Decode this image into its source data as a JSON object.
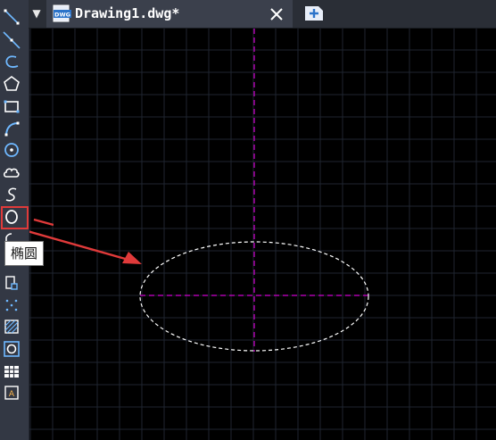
{
  "tabs": {
    "active": {
      "title": "Drawing1.dwg*",
      "icon": "dwg-file-icon"
    },
    "menu_icon": "▼",
    "new_tab_icon": "new-tab-icon"
  },
  "toolbar": {
    "tools": [
      {
        "name": "line-icon"
      },
      {
        "name": "construction-line-icon"
      },
      {
        "name": "polyline-icon"
      },
      {
        "name": "polygon-icon"
      },
      {
        "name": "rectangle-icon"
      },
      {
        "name": "arc-icon"
      },
      {
        "name": "circle-icon"
      },
      {
        "name": "revision-cloud-icon"
      },
      {
        "name": "spline-icon"
      },
      {
        "name": "ellipse-icon",
        "active": true
      },
      {
        "name": "insert-block-icon"
      },
      {
        "name": "make-block-icon"
      },
      {
        "name": "point-icon"
      },
      {
        "name": "hatch-icon"
      },
      {
        "name": "region-icon"
      },
      {
        "name": "table-icon"
      },
      {
        "name": "multiline-text-icon"
      }
    ]
  },
  "tooltip": {
    "text": "椭圆"
  },
  "colors": {
    "toolbar_bg": "#333844",
    "canvas_bg": "#000000",
    "grid": "#1f2530",
    "axis": "#d000d0",
    "ellipse": "#ffffff",
    "highlight": "#e03a3a",
    "arrow": "#e03a3a"
  }
}
